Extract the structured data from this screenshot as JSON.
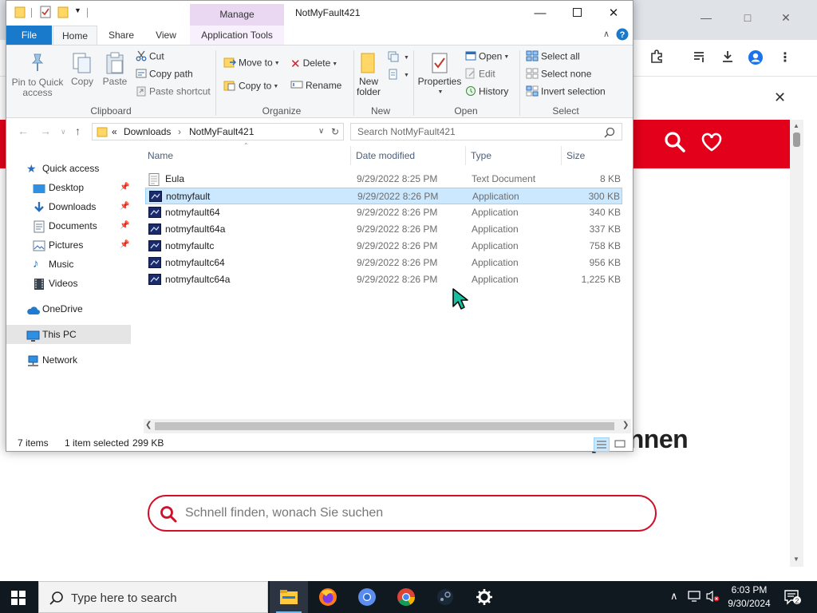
{
  "explorer": {
    "window_title": "NotMyFault421",
    "contextual_tab_group": "Manage",
    "tabs": {
      "file": "File",
      "home": "Home",
      "share": "Share",
      "view": "View",
      "application_tools": "Application Tools"
    },
    "ribbon": {
      "clipboard": {
        "label": "Clipboard",
        "pin": "Pin to Quick access",
        "copy": "Copy",
        "paste": "Paste",
        "cut": "Cut",
        "copy_path": "Copy path",
        "paste_shortcut": "Paste shortcut"
      },
      "organize": {
        "label": "Organize",
        "move_to": "Move to",
        "copy_to": "Copy to",
        "delete": "Delete",
        "rename": "Rename"
      },
      "new": {
        "label": "New",
        "new_folder": "New folder"
      },
      "open": {
        "label": "Open",
        "properties": "Properties",
        "open": "Open",
        "edit": "Edit",
        "history": "History"
      },
      "select": {
        "label": "Select",
        "select_all": "Select all",
        "select_none": "Select none",
        "invert_selection": "Invert selection"
      }
    },
    "address": {
      "overflow": "«",
      "crumbs": [
        "Downloads",
        "NotMyFault421"
      ],
      "search_placeholder": "Search NotMyFault421"
    },
    "nav_pane": {
      "quick_access": "Quick access",
      "items": [
        {
          "label": "Desktop",
          "icon": "desktop-icon",
          "pinned": true
        },
        {
          "label": "Downloads",
          "icon": "downloads-icon",
          "pinned": true
        },
        {
          "label": "Documents",
          "icon": "documents-icon",
          "pinned": true
        },
        {
          "label": "Pictures",
          "icon": "pictures-icon",
          "pinned": true
        },
        {
          "label": "Music",
          "icon": "music-icon",
          "pinned": false
        },
        {
          "label": "Videos",
          "icon": "videos-icon",
          "pinned": false
        }
      ],
      "onedrive": "OneDrive",
      "this_pc": "This PC",
      "network": "Network"
    },
    "columns": {
      "name": "Name",
      "date_modified": "Date modified",
      "type": "Type",
      "size": "Size"
    },
    "files": [
      {
        "name": "Eula",
        "date": "9/29/2022 8:25 PM",
        "type": "Text Document",
        "size": "8 KB",
        "icon": "text-document-icon",
        "selected": false
      },
      {
        "name": "notmyfault",
        "date": "9/29/2022 8:26 PM",
        "type": "Application",
        "size": "300 KB",
        "icon": "application-icon",
        "selected": true
      },
      {
        "name": "notmyfault64",
        "date": "9/29/2022 8:26 PM",
        "type": "Application",
        "size": "340 KB",
        "icon": "application-icon",
        "selected": false
      },
      {
        "name": "notmyfault64a",
        "date": "9/29/2022 8:26 PM",
        "type": "Application",
        "size": "337 KB",
        "icon": "application-icon",
        "selected": false
      },
      {
        "name": "notmyfaultc",
        "date": "9/29/2022 8:26 PM",
        "type": "Application",
        "size": "758 KB",
        "icon": "application-icon",
        "selected": false
      },
      {
        "name": "notmyfaultc64",
        "date": "9/29/2022 8:26 PM",
        "type": "Application",
        "size": "956 KB",
        "icon": "application-icon",
        "selected": false
      },
      {
        "name": "notmyfaultc64a",
        "date": "9/29/2022 8:26 PM",
        "type": "Application",
        "size": "1,225 KB",
        "icon": "application-icon",
        "selected": false
      }
    ],
    "status": {
      "item_count": "7 items",
      "selection": "1 item selected",
      "selection_size": "299 KB"
    }
  },
  "browser": {
    "heading_fragment": "p:tinnen",
    "search_placeholder": "Schnell finden, wonach Sie suchen",
    "accent_color": "#e3001b"
  },
  "taskbar": {
    "search_placeholder": "Type here to search",
    "apps": [
      "file-explorer",
      "firefox",
      "chromium",
      "chrome",
      "steam",
      "settings"
    ],
    "time": "6:03 PM",
    "date": "9/30/2024",
    "notification_count": "2"
  }
}
